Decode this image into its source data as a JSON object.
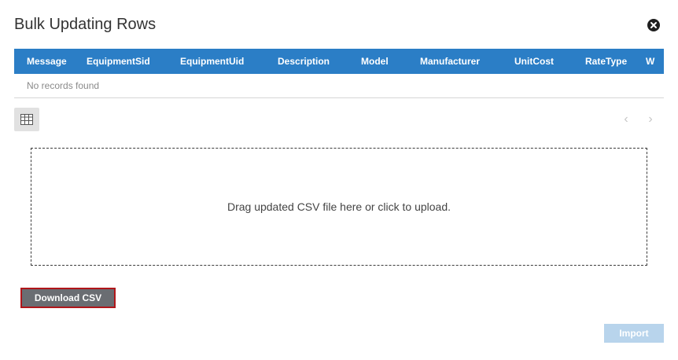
{
  "dialog": {
    "title": "Bulk Updating Rows",
    "close_icon": "close-circle-icon"
  },
  "grid": {
    "columns": [
      "Message",
      "EquipmentSid",
      "EquipmentUid",
      "Description",
      "Model",
      "Manufacturer",
      "UnitCost",
      "RateType",
      "W"
    ],
    "empty_text": "No records found",
    "column_chooser_icon": "table-columns-icon",
    "prev_icon": "chevron-left-icon",
    "next_icon": "chevron-right-icon"
  },
  "dropzone": {
    "text": "Drag updated CSV file here or click to upload."
  },
  "buttons": {
    "download_csv": "Download CSV",
    "import": "Import"
  },
  "colors": {
    "header_bg": "#2b7ec6",
    "download_border": "#b0161a",
    "download_bg": "#6a6d72",
    "import_bg": "#b8d4ec"
  }
}
